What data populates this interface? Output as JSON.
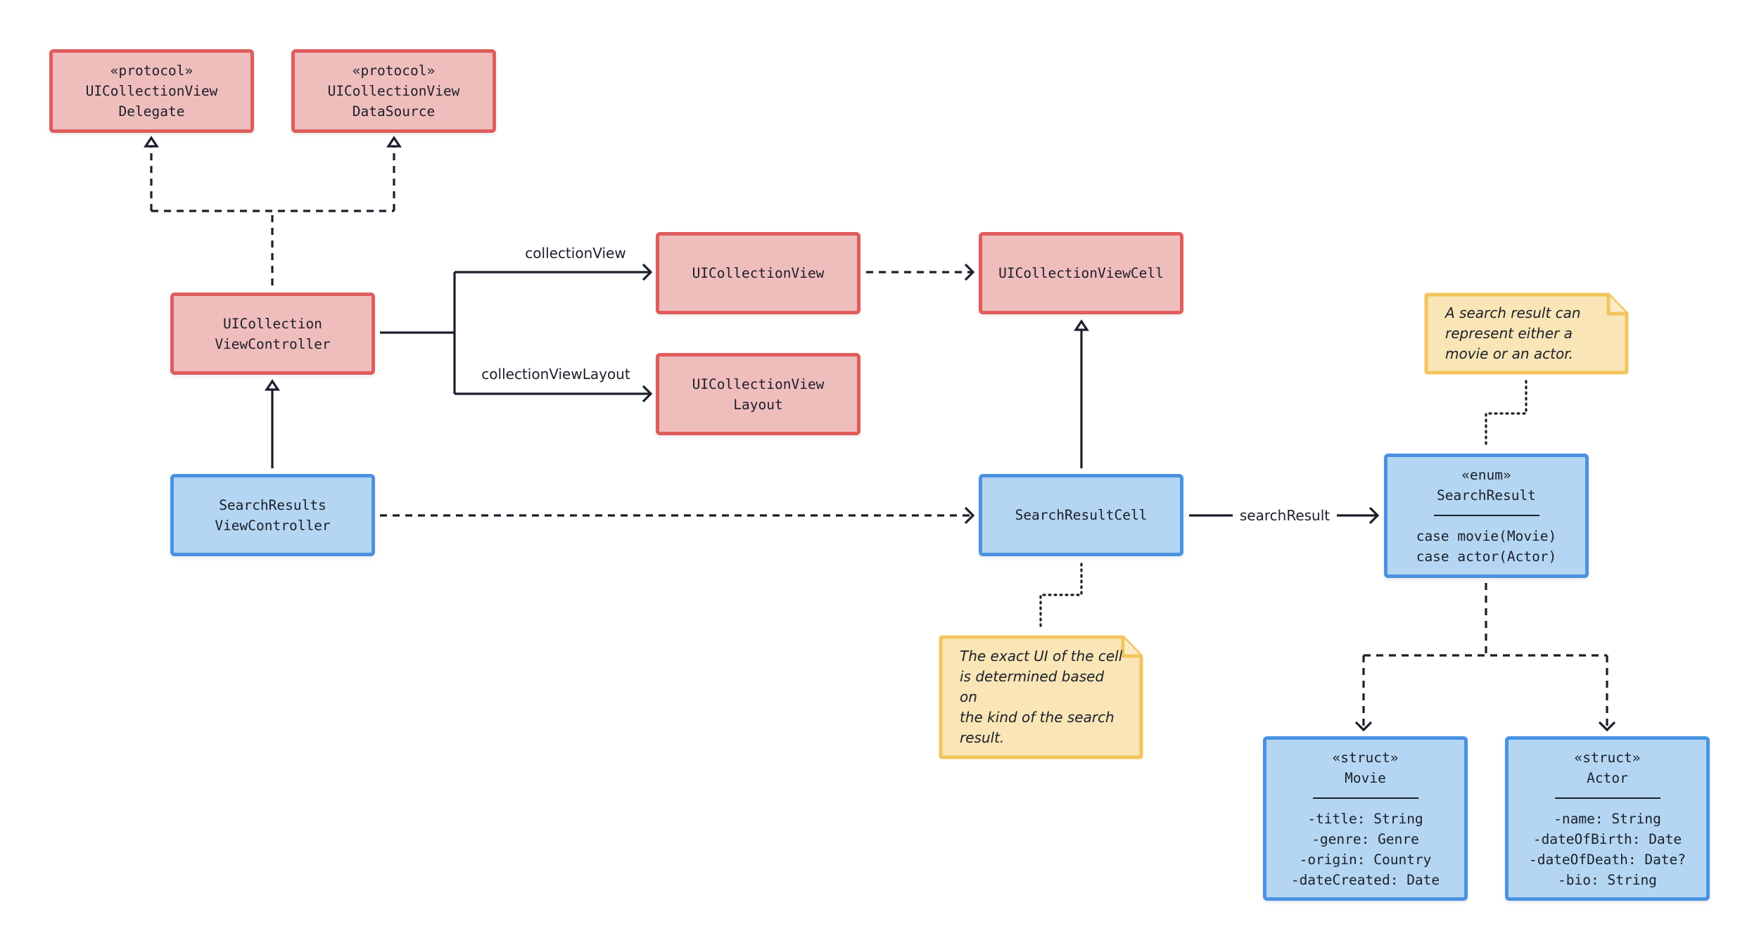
{
  "colors": {
    "framework_fill": "#f0bdbd",
    "framework_border": "#e05d5d",
    "app_fill": "#b4d6f2",
    "app_border": "#4a92e2",
    "note_fill": "#f9e5b6",
    "note_border": "#f2c55c",
    "line": "#1b1f2a"
  },
  "nodes": {
    "delegate": {
      "stereotype": "«protocol»",
      "lines": [
        "UICollectionView",
        "Delegate"
      ]
    },
    "datasource": {
      "stereotype": "«protocol»",
      "lines": [
        "UICollectionView",
        "DataSource"
      ]
    },
    "collection_vc": {
      "lines": [
        "UICollection",
        "ViewController"
      ]
    },
    "collection_view": {
      "lines": [
        "UICollectionView"
      ]
    },
    "collection_layout": {
      "lines": [
        "UICollectionView",
        "Layout"
      ]
    },
    "collection_cell": {
      "lines": [
        "UICollectionViewCell"
      ]
    },
    "search_vc": {
      "lines": [
        "SearchResults",
        "ViewController"
      ]
    },
    "search_cell": {
      "lines": [
        "SearchResultCell"
      ]
    },
    "search_result": {
      "stereotype": "«enum»",
      "name": "SearchResult",
      "members": [
        "case movie(Movie)",
        "case actor(Actor)"
      ]
    },
    "movie": {
      "stereotype": "«struct»",
      "name": "Movie",
      "members": [
        "-title: String",
        "-genre: Genre",
        "-origin: Country",
        "-dateCreated: Date"
      ]
    },
    "actor": {
      "stereotype": "«struct»",
      "name": "Actor",
      "members": [
        "-name: String",
        "-dateOfBirth: Date",
        "-dateOfDeath: Date?",
        "-bio: String"
      ]
    }
  },
  "notes": {
    "search_result_note": [
      "A search result can",
      "represent either a",
      "movie or an actor."
    ],
    "cell_note": [
      "The exact UI of the cell",
      "is determined based on",
      "the kind of the search",
      "result."
    ]
  },
  "edge_labels": {
    "collection_view": "collectionView",
    "collection_view_layout": "collectionViewLayout",
    "search_result": "searchResult"
  }
}
